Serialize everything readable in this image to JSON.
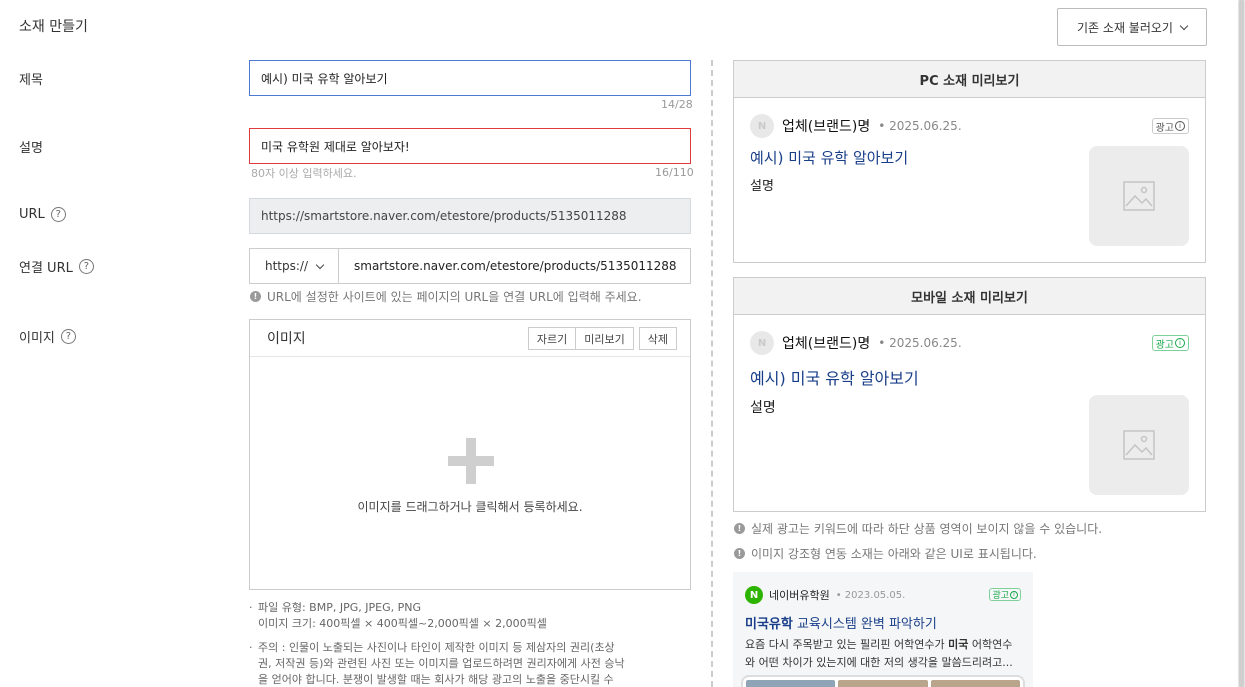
{
  "page_title": "소재 만들기",
  "load_button": "기존 소재 불러오기",
  "form": {
    "title": {
      "label": "제목",
      "value": "예시) 미국 유학 알아보기",
      "counter": "14/28"
    },
    "description": {
      "label": "설명",
      "value": "미국 유학원 제대로 알아보자!",
      "hint": "80자 이상 입력하세요.",
      "counter": "16/110"
    },
    "url": {
      "label": "URL",
      "value": "https://smartstore.naver.com/etestore/products/5135011288"
    },
    "connect_url": {
      "label": "연결 URL",
      "protocol": "https://",
      "value": "smartstore.naver.com/etestore/products/5135011288",
      "info": "URL에 설정한 사이트에 있는 페이지의 URL을 연결 URL에 입력해 주세요."
    },
    "image": {
      "label": "이미지",
      "box_title": "이미지",
      "buttons": {
        "crop": "자르기",
        "preview": "미리보기",
        "delete": "삭제"
      },
      "drop_text": "이미지를 드래그하거나 클릭해서 등록하세요.",
      "notes": [
        [
          "파일 유형: BMP, JPG, JPEG, PNG",
          "이미지 크기: 400픽셀 × 400픽셀~2,000픽셀 × 2,000픽셀"
        ],
        [
          "주의 : 인물이 노출되는 사진이나 타인이 제작한 이미지 등 제삼자의 권리(초상",
          "권, 저작권 등)와 관련된 사진 또는 이미지를 업로드하려면 권리자에게 사전 승낙",
          "을 얻어야 합니다. 분쟁이 발생할 때는 회사가 해당 광고의 노출을 중단시킬 수"
        ]
      ]
    }
  },
  "preview": {
    "pc": {
      "header": "PC 소재 미리보기",
      "brand": "업체(브랜드)명",
      "date": "• 2025.06.25.",
      "ad_badge": "광고",
      "title": "예시) 미국 유학 알아보기",
      "description": "설명"
    },
    "mobile": {
      "header": "모바일 소재 미리보기",
      "brand": "업체(브랜드)명",
      "date": "• 2025.06.25.",
      "ad_badge": "광고",
      "title": "예시) 미국 유학 알아보기",
      "description": "설명"
    },
    "info_1": "실제 광고는 키워드에 따라 하단 상품 영역이 보이지 않을 수 있습니다.",
    "info_2": "이미지 강조형 연동 소재는 아래와 같은 UI로 표시됩니다.",
    "example": {
      "brand": "네이버유학원",
      "date": "• 2023.05.05.",
      "ad_badge": "광고",
      "title_bold": "미국유학",
      "title_rest": " 교육시스템 완벽 파악하기",
      "desc_line1_pre": "요즘 다시 주목받고 있는 필리핀 어학연수가 ",
      "desc_line1_bold": "미국",
      "desc_line1_post": " 어학연수",
      "desc_line2": "와 어떤 차이가 있는지에 대한 저의 생각을 말씀드리려고..."
    }
  },
  "colors": {
    "accent": "#4a7bd0",
    "error": "#e03b3b",
    "ad_green": "#19a84a",
    "link_blue": "#1a3f8a"
  }
}
